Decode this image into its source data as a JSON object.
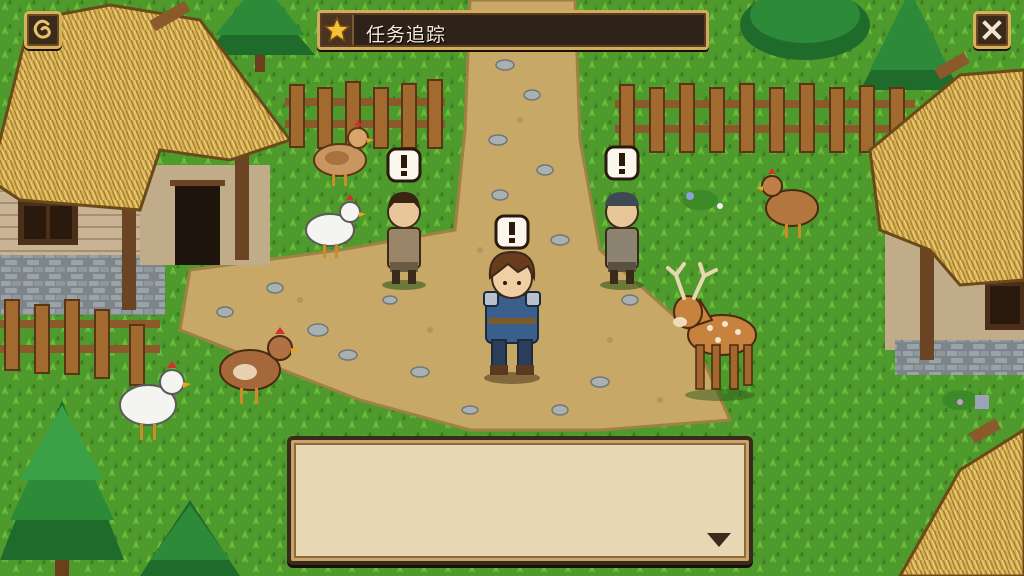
{
  "hud": {
    "quest_tracker_label": "任务追踪",
    "menu_icon": "swirl-menu-icon",
    "close_icon": "close-icon",
    "quest_icon": "star-icon"
  },
  "dialog": {
    "text": "",
    "continue_icon": "triangle-down-icon"
  },
  "scene": {
    "quest_markers": 3,
    "colors": {
      "grass": "#4f9a2c",
      "path": "#c8a867",
      "thatch": "#d9b458",
      "ui_frame": "#d1ab60",
      "ui_dark": "#2f2218",
      "dialog_bg": "#e8d7b3"
    }
  }
}
